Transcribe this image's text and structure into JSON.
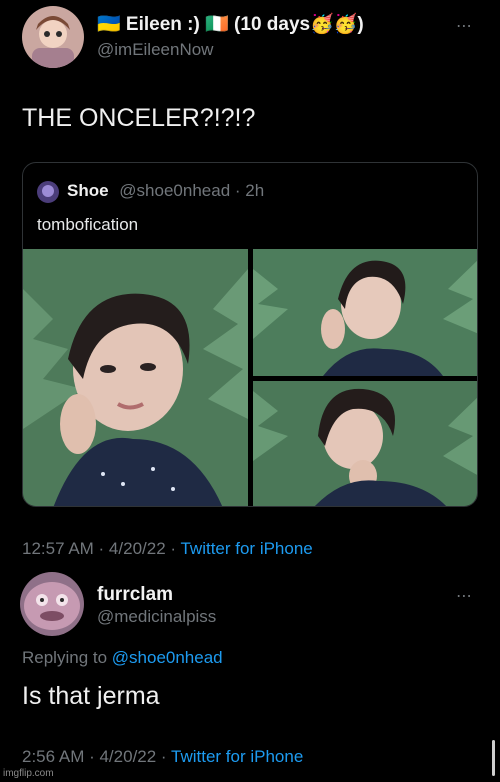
{
  "tweet1": {
    "display_name": "🇺🇦 Eileen :) 🇮🇪  (10 days🥳🥳)",
    "handle": "@imEileenNow",
    "text": "THE ONCELER?!?!?",
    "more_icon": "⋯",
    "quote": {
      "name": "Shoe",
      "handle_time": "@shoe0nhead · 2h",
      "text": "tombofication"
    },
    "time": "12:57 AM · 4/20/22 · ",
    "source": "Twitter for iPhone"
  },
  "reply": {
    "display_name": "furrclam",
    "handle": "@medicinalpiss",
    "replying_prefix": "Replying to ",
    "replying_handle": "@shoe0nhead",
    "text": "Is that jerma",
    "more_icon": "⋯",
    "time": "2:56 AM · 4/20/22 · ",
    "source": "Twitter for iPhone"
  },
  "watermark": "imgflip.com",
  "colors": {
    "link": "#1d9bf0",
    "muted": "#71767b",
    "background": "#000000"
  }
}
